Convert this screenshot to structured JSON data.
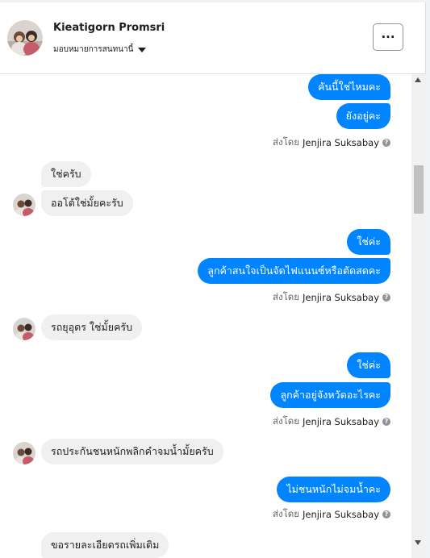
{
  "header": {
    "contact_name": "Kieatigorn Promsri",
    "assign_label": "มอบหมายการสนทนานี้",
    "more_label": "···"
  },
  "sent_by": {
    "prefix": "ส่งโดย",
    "agent": "Jenjira Suksabay",
    "help": "?"
  },
  "messages": [
    {
      "dir": "out",
      "text": "คันนี้ใช่ไหมคะ"
    },
    {
      "dir": "out",
      "text": "ยังอยู่คะ"
    },
    {
      "dir": "in",
      "text": "ใช่ครับ"
    },
    {
      "dir": "in",
      "text": "ออโต้ใช่มั้ยคะรับ"
    },
    {
      "dir": "out",
      "text": "ใช่ค่ะ"
    },
    {
      "dir": "out",
      "text": "ลูกค้าสนใจเป็นจัดไฟแนนซ์หรือตัดสดคะ"
    },
    {
      "dir": "in",
      "text": "รถยุอุดร ใช่มั้ยครับ"
    },
    {
      "dir": "out",
      "text": "ใช่ค่ะ"
    },
    {
      "dir": "out",
      "text": "ลูกค้าอยู่จังหวัดอะไรคะ"
    },
    {
      "dir": "in",
      "text": "รถประกันชนหนักพลิกคำจมน้ำมั้ยครับ"
    },
    {
      "dir": "out",
      "text": "ไม่ชนหนักไม่จมน้ำคะ"
    },
    {
      "dir": "in",
      "text": "ขอรายละเอียดรถเพิ่มเติม"
    }
  ]
}
